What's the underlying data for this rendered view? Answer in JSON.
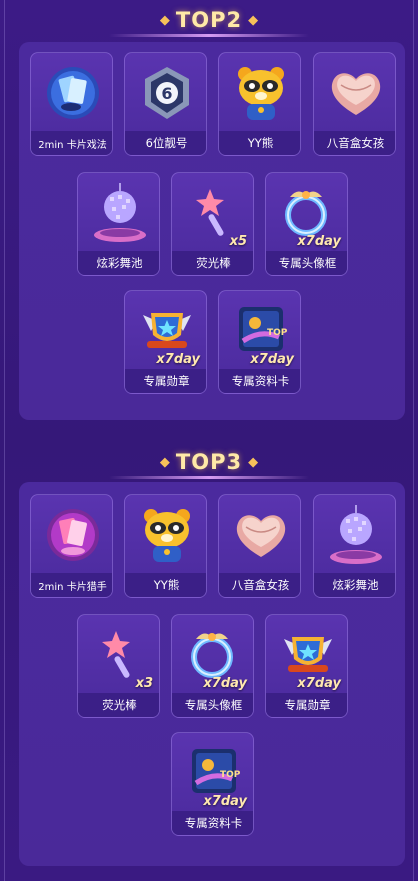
{
  "sections": [
    {
      "title": "TOP2",
      "items": [
        {
          "label": "2min 卡片戏法",
          "icon": "card-magic-icon",
          "qty": ""
        },
        {
          "label": "6位靓号",
          "icon": "number-6-badge-icon",
          "qty": ""
        },
        {
          "label": "YY熊",
          "icon": "yy-bear-icon",
          "qty": ""
        },
        {
          "label": "八音盒女孩",
          "icon": "music-box-icon",
          "qty": ""
        },
        {
          "label": "炫彩舞池",
          "icon": "disco-ball-icon",
          "qty": ""
        },
        {
          "label": "荧光棒",
          "icon": "glow-stick-icon",
          "qty": "x5"
        },
        {
          "label": "专属头像框",
          "icon": "avatar-frame-icon",
          "qty": "x7day"
        },
        {
          "label": "专属勋章",
          "icon": "medal-icon",
          "qty": "x7day"
        },
        {
          "label": "专属资料卡",
          "icon": "profile-card-icon",
          "qty": "x7day"
        }
      ]
    },
    {
      "title": "TOP3",
      "items": [
        {
          "label": "2min 卡片猎手",
          "icon": "card-hunter-icon",
          "qty": ""
        },
        {
          "label": "YY熊",
          "icon": "yy-bear-icon",
          "qty": ""
        },
        {
          "label": "八音盒女孩",
          "icon": "music-box-icon",
          "qty": ""
        },
        {
          "label": "炫彩舞池",
          "icon": "disco-ball-icon",
          "qty": ""
        },
        {
          "label": "荧光棒",
          "icon": "glow-stick-icon",
          "qty": "x3"
        },
        {
          "label": "专属头像框",
          "icon": "avatar-frame-icon",
          "qty": "x7day"
        },
        {
          "label": "专属勋章",
          "icon": "medal-icon",
          "qty": "x7day"
        },
        {
          "label": "专属资料卡",
          "icon": "profile-card-icon",
          "qty": "x7day"
        }
      ]
    }
  ],
  "colors": {
    "background": "#3a1a82",
    "panel": "#4b2a9e",
    "title": "#ffe9a8",
    "qty": "#ffe8b0"
  }
}
